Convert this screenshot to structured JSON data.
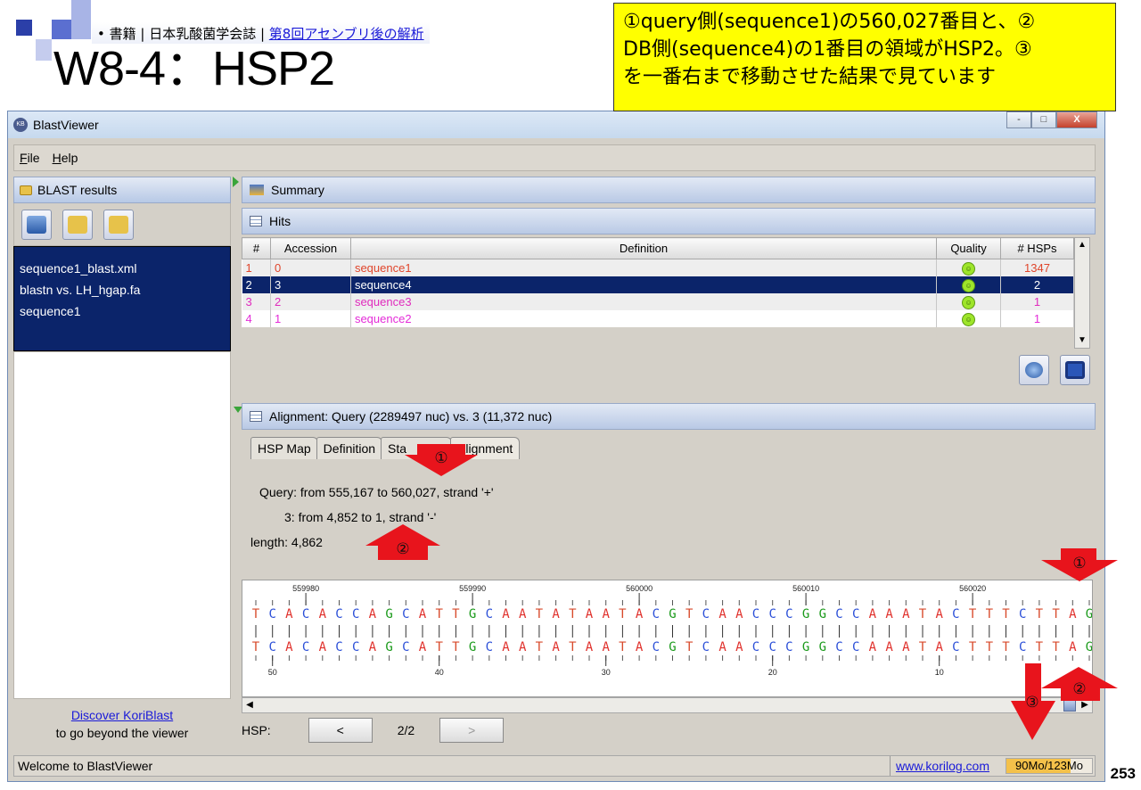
{
  "slide": {
    "breadcrumb_items": [
      "• 書籍 | 日本乳酸菌学会誌 | ",
      "第8回アセンブリ後の解析"
    ],
    "title": "W8-4：HSP2",
    "note": "①query側(sequence1)の560,027番目と、②\nDB側(sequence4)の1番目の領域がHSP2。③\nを一番右まで移動させた結果で見ています",
    "slide_number": "253",
    "markers": [
      "①",
      "②",
      "③"
    ]
  },
  "window": {
    "title": "BlastViewer",
    "controls": [
      "-",
      "□",
      "X"
    ]
  },
  "menu": {
    "items": [
      "File",
      "Help"
    ],
    "mnemonics": [
      "F",
      "H"
    ]
  },
  "left": {
    "header": "BLAST results",
    "files": [
      "sequence1_blast.xml",
      "blastn vs. LH_hgap.fa",
      "sequence1"
    ],
    "footer_link": "Discover KoriBlast",
    "footer_text": "to go beyond the viewer"
  },
  "summary": {
    "label": "Summary"
  },
  "hits": {
    "label": "Hits",
    "columns": [
      "#",
      "Accession",
      "Definition",
      "Quality",
      "# HSPs"
    ],
    "rows": [
      {
        "num": "1",
        "acc": "0",
        "def": "sequence1",
        "hsps": "1347",
        "color": "#e0452b"
      },
      {
        "num": "2",
        "acc": "3",
        "def": "sequence4",
        "hsps": "2",
        "color": "#ffffff"
      },
      {
        "num": "3",
        "acc": "2",
        "def": "sequence3",
        "hsps": "1",
        "color": "#e02bbd"
      },
      {
        "num": "4",
        "acc": "1",
        "def": "sequence2",
        "hsps": "1",
        "color": "#e42bd8"
      }
    ]
  },
  "alignment": {
    "header": "Alignment: Query (2289497 nuc) vs. 3 (11,372 nuc)",
    "tabs": [
      "HSP Map",
      "Definition",
      "Sta",
      "Alignment"
    ],
    "query_line": "Query: from 555,167 to 560,027, strand '+'",
    "subject_line": "3: from 4,852 to 1, strand '-'",
    "length_line": "length: 4,862",
    "top_ticks": [
      "559980",
      "559990",
      "560000",
      "560010",
      "560020"
    ],
    "bottom_ticks": [
      "50",
      "40",
      "30",
      "20",
      "10"
    ],
    "sequence": "TCACACCAGCATTGCAATATAATACGTCAACCCGGCCAAATACTTTCTTAG"
  },
  "hsp_nav": {
    "label": "HSP:",
    "prev": "<",
    "position": "2/2",
    "next": ">"
  },
  "status": {
    "message": "Welcome to BlastViewer",
    "link": "www.korilog.com",
    "memory": "90Mo/123Mo",
    "memory_fraction": 0.73
  },
  "colors": {
    "A": "#e0302b",
    "C": "#2b4fd8",
    "G": "#1a9a1a",
    "T": "#d84a2b",
    "selection": "#0b246a"
  }
}
